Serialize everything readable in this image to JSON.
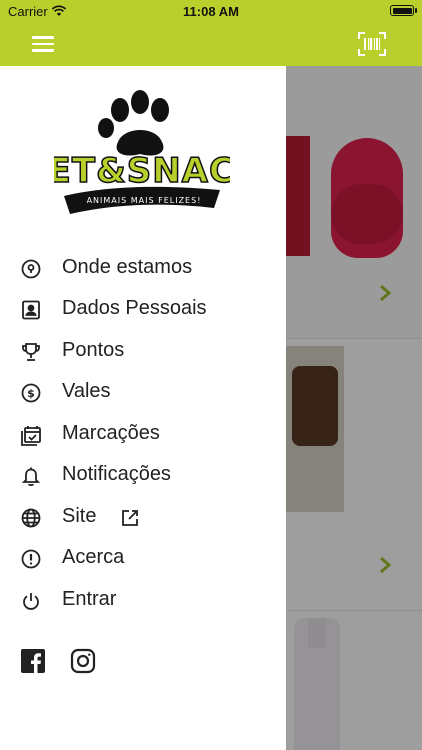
{
  "status_bar": {
    "carrier": "Carrier",
    "time": "11:08 AM"
  },
  "top_bar": {
    "menu_icon": "hamburger-icon",
    "scan_icon": "barcode-icon",
    "color": "#b8cf2c"
  },
  "drawer": {
    "logo": {
      "title": "PET&SNACK",
      "tagline": "ANIMAIS MAIS FELIZES!"
    },
    "items": [
      {
        "label": "Onde estamos",
        "icon": "location-icon"
      },
      {
        "label": "Dados Pessoais",
        "icon": "contact-card-icon"
      },
      {
        "label": "Pontos",
        "icon": "trophy-icon"
      },
      {
        "label": "Vales",
        "icon": "dollar-coin-icon"
      },
      {
        "label": "Marcações",
        "icon": "calendar-check-icon"
      },
      {
        "label": "Notificações",
        "icon": "bell-icon"
      },
      {
        "label": "Site",
        "icon": "globe-icon",
        "external_icon": "external-link-icon"
      },
      {
        "label": "Acerca",
        "icon": "info-circle-icon"
      },
      {
        "label": "Entrar",
        "icon": "power-icon"
      }
    ],
    "social": [
      {
        "name": "facebook",
        "icon": "facebook-icon"
      },
      {
        "name": "instagram",
        "icon": "instagram-icon"
      }
    ]
  },
  "colors": {
    "accent": "#b8cf2c",
    "text": "#222222",
    "chevron": "#9bbf2a"
  }
}
